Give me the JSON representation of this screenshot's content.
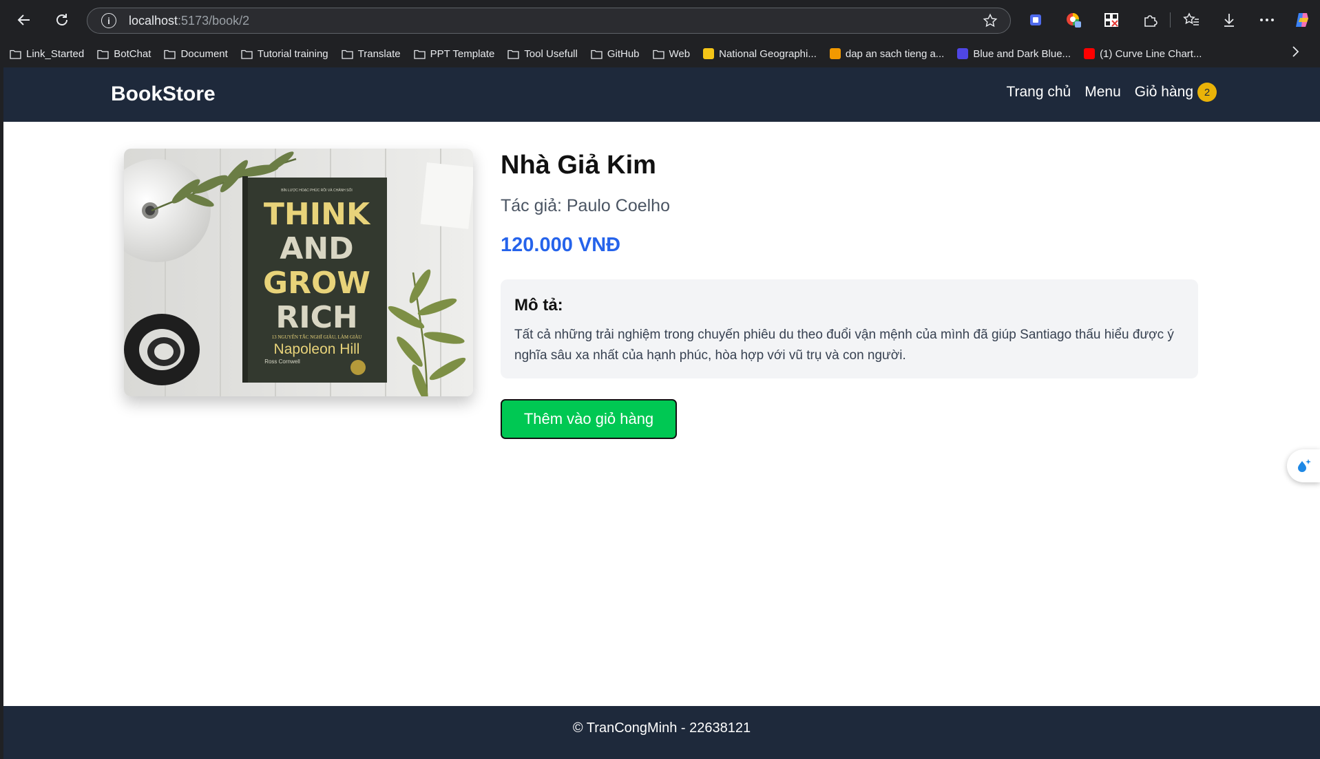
{
  "browser": {
    "url_host": "localhost",
    "url_path": ":5173/book/2",
    "bookmarks": [
      {
        "label": "Link_Started",
        "icon": "folder-icon"
      },
      {
        "label": "BotChat",
        "icon": "folder-icon"
      },
      {
        "label": "Document",
        "icon": "folder-icon"
      },
      {
        "label": "Tutorial training",
        "icon": "folder-icon"
      },
      {
        "label": "Translate",
        "icon": "folder-icon"
      },
      {
        "label": "PPT Template",
        "icon": "folder-icon"
      },
      {
        "label": "Tool Usefull",
        "icon": "folder-icon"
      },
      {
        "label": "GitHub",
        "icon": "folder-icon"
      },
      {
        "label": "Web",
        "icon": "folder-icon"
      },
      {
        "label": "National Geographi...",
        "icon": "natgeo-favicon",
        "color": "#f5c518"
      },
      {
        "label": "dap an sach tieng a...",
        "icon": "doc-favicon",
        "color": "#f29900"
      },
      {
        "label": "Blue and Dark Blue...",
        "icon": "canva-favicon",
        "color": "#4f46e5"
      },
      {
        "label": "(1) Curve Line Chart...",
        "icon": "youtube-favicon",
        "color": "#ff0000"
      }
    ]
  },
  "site": {
    "brand": "BookStore",
    "nav": {
      "home": "Trang chủ",
      "menu": "Menu",
      "cart": "Giỏ hàng",
      "cart_count": "2"
    },
    "footer": "© TranCongMinh - 22638121"
  },
  "book": {
    "title": "Nhà Giả Kim",
    "author": "Tác giả: Paulo Coelho",
    "price": "120.000 VNĐ",
    "description_heading": "Mô tả:",
    "description": "Tất cả những trải nghiệm trong chuyến phiêu du theo đuổi vận mệnh của mình đã giúp Santiago thấu hiểu được ý nghĩa sâu xa nhất của hạnh phúc, hòa hợp với vũ trụ và con người.",
    "add_to_cart": "Thêm vào giỏ hàng",
    "cover_text": {
      "top_tagline": "BÍN LƯỢC HOẠC PHÚC RỒI VÀ CHẢNH SỐI",
      "line1": "THINK",
      "line2": "AND",
      "line3": "GROW",
      "line4": "RICH",
      "subtitle": "13 NGUYÊN TẮC NGHĨ GIÀU, LÀM GIÀU",
      "author": "Napoleon Hill",
      "coauthor": "Ross Cornwell"
    }
  },
  "colors": {
    "header_bg": "#1e293b",
    "price": "#2563eb",
    "button": "#00c853",
    "badge": "#eab308"
  }
}
